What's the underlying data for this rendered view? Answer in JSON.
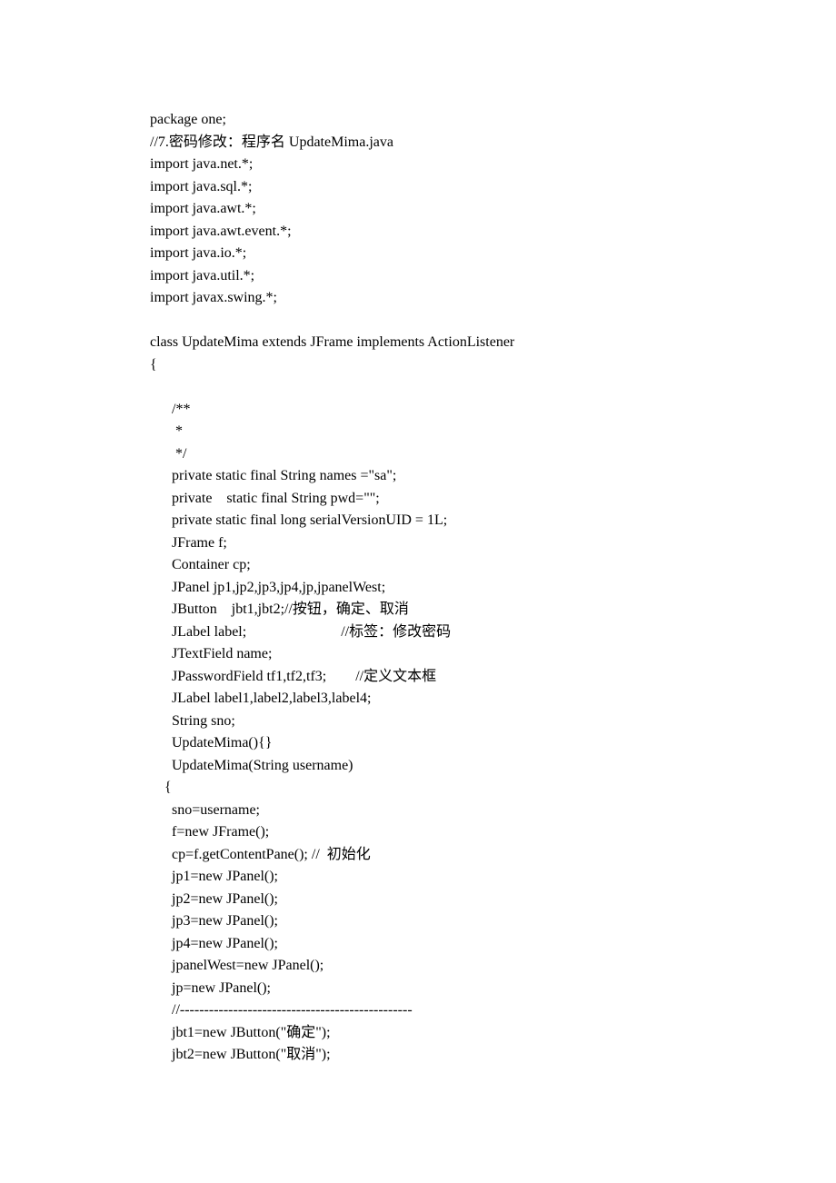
{
  "code_lines": [
    "package one;",
    "//7.密码修改：程序名 UpdateMima.java",
    "import java.net.*;",
    "import java.sql.*;",
    "import java.awt.*;",
    "import java.awt.event.*;",
    "import java.io.*;",
    "import java.util.*;",
    "import javax.swing.*;",
    "",
    "class UpdateMima extends JFrame implements ActionListener",
    "{",
    "",
    "      /**",
    "       *",
    "       */",
    "      private static final String names =\"sa\";",
    "      private    static final String pwd=\"\";",
    "      private static final long serialVersionUID = 1L;",
    "      JFrame f;",
    "      Container cp;",
    "      JPanel jp1,jp2,jp3,jp4,jp,jpanelWest;",
    "      JButton    jbt1,jbt2;//按钮，确定、取消",
    "      JLabel label;                          //标签：修改密码",
    "      JTextField name;",
    "      JPasswordField tf1,tf2,tf3;        //定义文本框",
    "      JLabel label1,label2,label3,label4;",
    "      String sno;",
    "      UpdateMima(){}",
    "      UpdateMima(String username)",
    "    {",
    "      sno=username;",
    "      f=new JFrame();",
    "      cp=f.getContentPane(); //  初始化",
    "      jp1=new JPanel();",
    "      jp2=new JPanel();",
    "      jp3=new JPanel();",
    "      jp4=new JPanel();",
    "      jpanelWest=new JPanel();",
    "      jp=new JPanel();",
    "      //------------------------------------------------",
    "      jbt1=new JButton(\"确定\");",
    "      jbt2=new JButton(\"取消\");"
  ]
}
